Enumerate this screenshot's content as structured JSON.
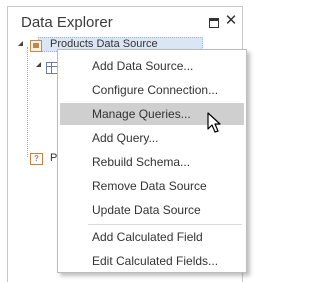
{
  "panel": {
    "title": "Data Explorer",
    "pin_icon": "pin-icon",
    "close_glyph": "✕"
  },
  "tree": {
    "root_label": "Products Data Source",
    "second_root_label": "P",
    "second_root_icon_glyph": "?"
  },
  "context_menu": {
    "items": [
      {
        "label": "Add Data Source..."
      },
      {
        "label": "Configure Connection..."
      },
      {
        "label": "Manage Queries..."
      },
      {
        "label": "Add Query..."
      },
      {
        "label": "Rebuild Schema..."
      },
      {
        "label": "Remove Data Source"
      },
      {
        "label": "Update Data Source"
      },
      {
        "label": "Add Calculated Field"
      },
      {
        "label": "Edit Calculated Fields..."
      }
    ],
    "hovered_item": "Manage Queries..."
  },
  "colors": {
    "hover_bg": "#cfcfcf",
    "selection_bg": "#dbe6f4"
  }
}
